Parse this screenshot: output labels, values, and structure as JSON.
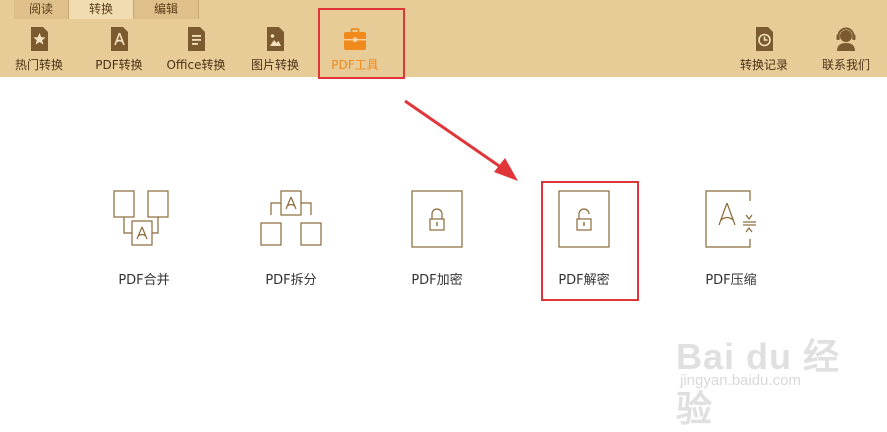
{
  "tabs": [
    {
      "label": "阅读"
    },
    {
      "label": "转换"
    },
    {
      "label": "编辑"
    }
  ],
  "toolbar": {
    "items": [
      {
        "label": "热门转换",
        "icon": "star-doc-icon"
      },
      {
        "label": "PDF转换",
        "icon": "pdf-doc-icon"
      },
      {
        "label": "Office转换",
        "icon": "office-doc-icon"
      },
      {
        "label": "图片转换",
        "icon": "image-doc-icon"
      },
      {
        "label": "PDF工具",
        "icon": "toolbox-icon"
      }
    ],
    "right_items": [
      {
        "label": "转换记录",
        "icon": "history-icon"
      },
      {
        "label": "联系我们",
        "icon": "support-icon"
      }
    ]
  },
  "tools": [
    {
      "label": "PDF合并",
      "icon": "merge-icon"
    },
    {
      "label": "PDF拆分",
      "icon": "split-icon"
    },
    {
      "label": "PDF加密",
      "icon": "lock-icon"
    },
    {
      "label": "PDF解密",
      "icon": "unlock-icon"
    },
    {
      "label": "PDF压缩",
      "icon": "compress-icon"
    }
  ],
  "watermark": {
    "brand": "Bai du 经验",
    "site": "jingyan.baidu.com"
  },
  "colors": {
    "toolbar_bg": "#e8cc98",
    "accent": "#f08a1c",
    "highlight": "#e0363a",
    "icon_brown": "#8a6a3a"
  }
}
